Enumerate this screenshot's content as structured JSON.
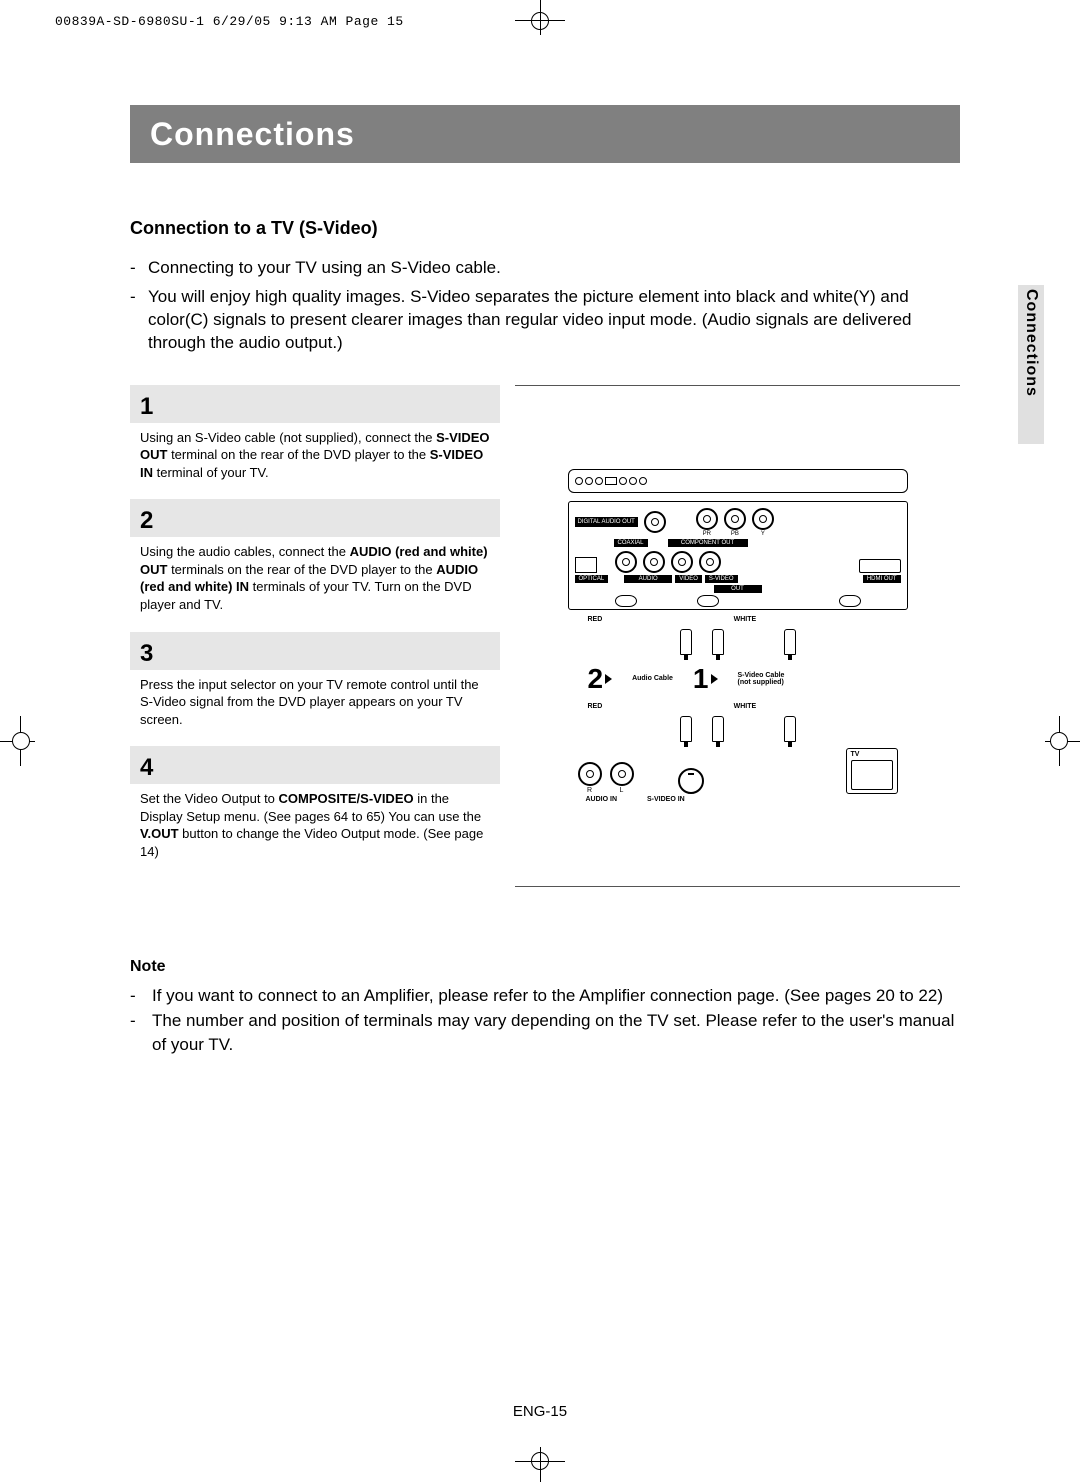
{
  "header_line": "00839A-SD-6980SU-1  6/29/05  9:13 AM  Page 15",
  "title": "Connections",
  "side_tab": "Connections",
  "section_title": "Connection to a TV (S-Video)",
  "intro": [
    "Connecting to your TV using an S-Video cable.",
    "You will enjoy high quality images. S-Video separates the picture element into black and white(Y) and color(C) signals to present clearer images than regular video input mode. (Audio signals are delivered through the audio output.)"
  ],
  "steps": [
    {
      "num": "1",
      "html": "Using an S-Video cable (not supplied), connect the <b>S-VIDEO OUT</b> terminal on the rear of the DVD player to the <b>S-VIDEO IN</b> terminal of your TV."
    },
    {
      "num": "2",
      "html": "Using the audio cables, connect the <b>AUDIO (red and white) OUT</b> terminals on the rear of the DVD player to the <b>AUDIO (red and white) IN</b> terminals of your TV. Turn on the DVD player and TV."
    },
    {
      "num": "3",
      "html": "Press the input selector on your TV remote control until the S-Video signal from the DVD player appears on your TV screen."
    },
    {
      "num": "4",
      "html": "Set the Video Output to <b>COMPOSITE/S-VIDEO</b> in the Display Setup menu. (See pages 64 to 65) You can use the <b>V.OUT</b> button to change the Video Output mode. (See page 14)"
    }
  ],
  "note_title": "Note",
  "notes": [
    "If you want to connect to an Amplifier, please refer to the Amplifier connection page. (See pages 20 to 22)",
    "The number and position of terminals may vary depending on the TV set. Please refer to the user's manual of your TV."
  ],
  "page_number": "ENG-15",
  "diagram": {
    "labels": {
      "digital_audio_out": "DIGITAL AUDIO OUT",
      "coaxial": "COAXIAL",
      "component_out": "COMPONENT OUT",
      "pr": "PR",
      "pb": "PB",
      "y": "Y",
      "optical": "OPTICAL",
      "audio": "AUDIO",
      "video": "VIDEO",
      "s_video": "S-VIDEO",
      "out": "OUT",
      "hdmi_out": "HDMI OUT",
      "red": "RED",
      "white": "WHITE",
      "audio_cable": "Audio Cable",
      "svideo_cable": "S-Video Cable (not supplied)",
      "r": "R",
      "l": "L",
      "audio_in": "AUDIO IN",
      "svideo_in": "S-VIDEO IN",
      "tv": "TV",
      "step2": "2",
      "step1": "1"
    }
  }
}
